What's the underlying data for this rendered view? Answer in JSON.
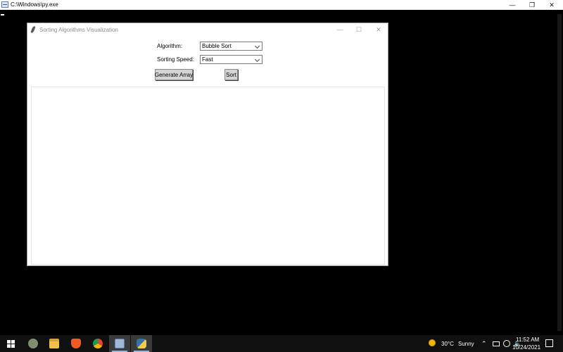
{
  "console": {
    "title": "C:\\Windows\\py.exe",
    "controls": [
      "—",
      "❐",
      "✕"
    ]
  },
  "tk": {
    "title": "Sorting Algorithms Visualization",
    "controls": [
      "—",
      "☐",
      "✕"
    ],
    "algorithm_label": "Algorithm:",
    "algorithm_value": "Bubble Sort",
    "speed_label": "Sorting Speed:",
    "speed_value": "Fast",
    "generate_button": "Generate Array",
    "sort_button": "Sort"
  },
  "taskbar": {
    "apps": [
      "start-icon",
      "feather-icon",
      "file-explorer-icon",
      "brave-icon",
      "chrome-icon",
      "py-launcher-icon",
      "python-icon"
    ],
    "weather_temp": "30°C",
    "weather_text": "Sunny",
    "time": "11:52 AM",
    "date": "10/24/2021"
  },
  "colors": {
    "taskbar_bg": "#101010",
    "accent": "#8fb8e8"
  }
}
